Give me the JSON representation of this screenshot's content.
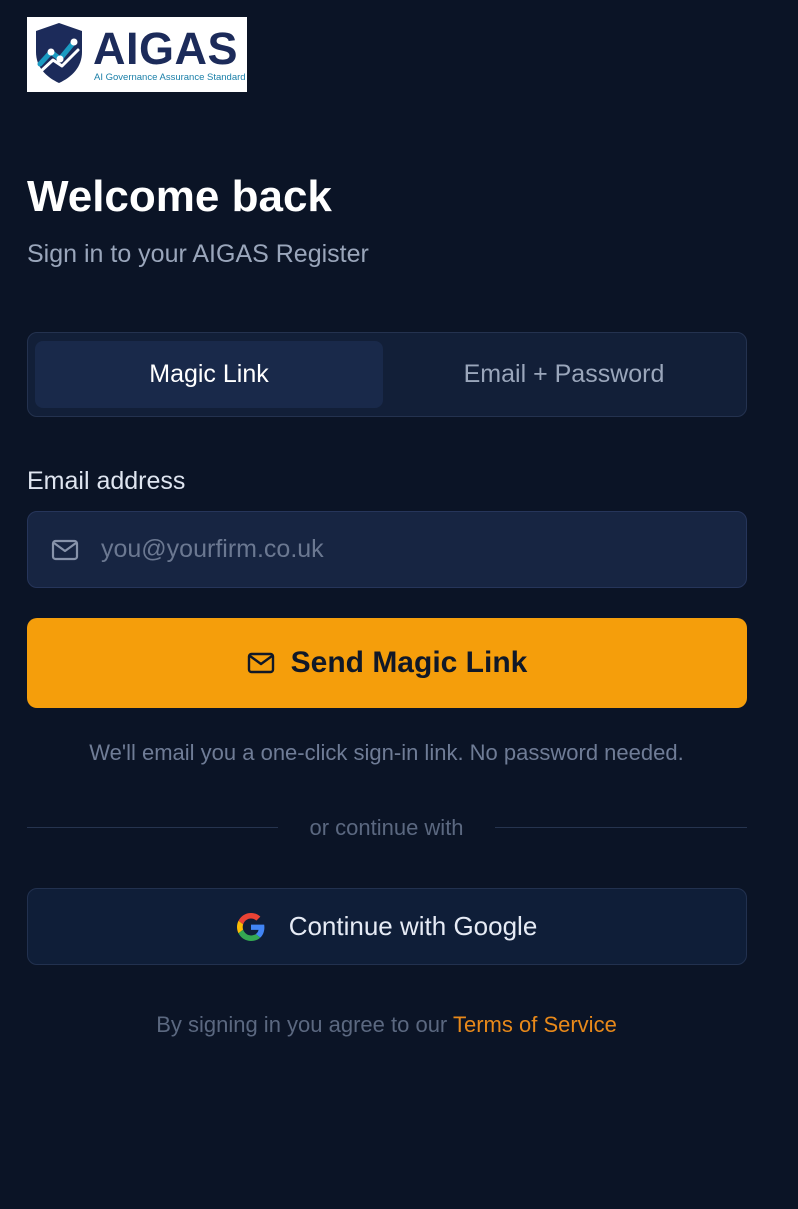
{
  "brand": {
    "name": "AIGAS",
    "tagline": "AI Governance Assurance Standard",
    "colors": {
      "navy": "#1c2b5a",
      "teal": "#1a7fa8"
    }
  },
  "header": {
    "title": "Welcome back",
    "subtitle": "Sign in to your AIGAS Register"
  },
  "tabs": [
    {
      "label": "Magic Link",
      "active": true
    },
    {
      "label": "Email + Password",
      "active": false
    }
  ],
  "form": {
    "email_label": "Email address",
    "email_placeholder": "you@yourfirm.co.uk",
    "email_value": "",
    "email_icon": "mail-icon",
    "submit_label": "Send Magic Link",
    "submit_icon": "mail-icon",
    "helper_text": "We'll email you a one-click sign-in link. No password needed."
  },
  "divider": {
    "text": "or continue with"
  },
  "oauth": {
    "google_label": "Continue with Google",
    "google_icon": "google-icon"
  },
  "footer": {
    "terms_prefix": "By signing in you agree to our",
    "terms_link": "Terms of Service"
  },
  "colors": {
    "background": "#0b1426",
    "accent": "#f59e0b",
    "link": "#e8891a",
    "panel": "#121f38",
    "input_bg": "#172542"
  }
}
